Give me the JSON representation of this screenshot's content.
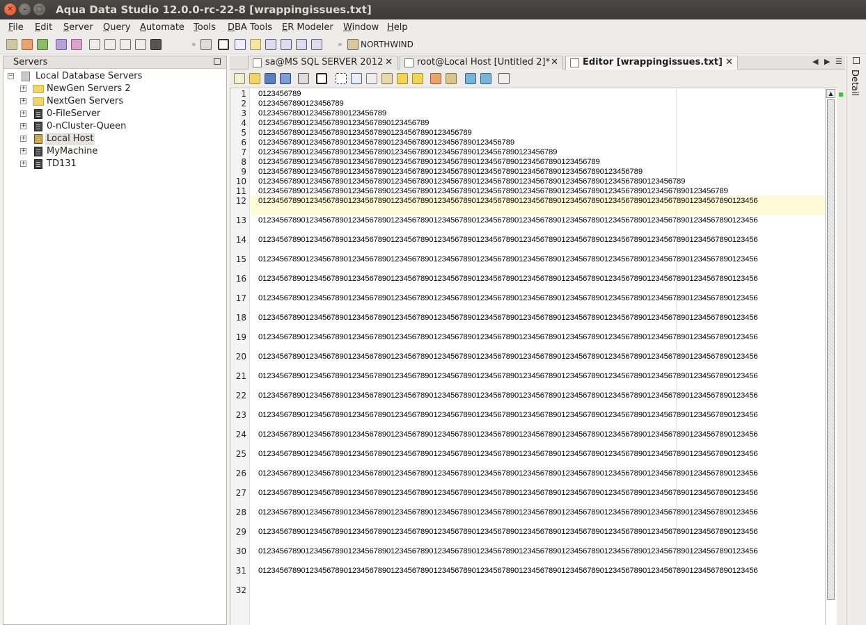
{
  "window": {
    "title": "Aqua Data Studio 12.0.0-rc-22-8 [wrappingissues.txt]"
  },
  "menu": [
    "File",
    "Edit",
    "Server",
    "Query",
    "Automate",
    "Tools",
    "DBA Tools",
    "ER Modeler",
    "Window",
    "Help"
  ],
  "toolbar": {
    "connection_label": "NORTHWIND"
  },
  "servers_panel": {
    "title": "Servers",
    "root": "Local Database Servers",
    "items": [
      {
        "label": "NewGen Servers 2",
        "icon": "folder-icon"
      },
      {
        "label": "NextGen Servers",
        "icon": "folder-icon"
      },
      {
        "label": "0-FileServer",
        "icon": "server-icon"
      },
      {
        "label": "0-nCluster-Queen",
        "icon": "server-icon"
      },
      {
        "label": "Local Host",
        "icon": "server-icon",
        "selected": true
      },
      {
        "label": "MyMachine",
        "icon": "server-icon"
      },
      {
        "label": "TD131",
        "icon": "server-icon"
      }
    ]
  },
  "tabs": [
    {
      "label": "sa@MS SQL SERVER 2012"
    },
    {
      "label": "root@Local Host [Untitled 2]*"
    },
    {
      "label": "Editor [wrappingissues.txt]",
      "active": true
    }
  ],
  "detail_panel": {
    "label": "Detail"
  },
  "editor": {
    "lines": [
      "0123456789",
      "01234567890123456789",
      "012345678901234567890123456789",
      "0123456789012345678901234567890123456789",
      "01234567890123456789012345678901234567890123456789",
      "012345678901234567890123456789012345678901234567890123456789",
      "0123456789012345678901234567890123456789012345678901234567890123456789",
      "01234567890123456789012345678901234567890123456789012345678901234567890123456789",
      "012345678901234567890123456789012345678901234567890123456789012345678901234567890123456789",
      "0123456789012345678901234567890123456789012345678901234567890123456789012345678901234567890123456789",
      "01234567890123456789012345678901234567890123456789012345678901234567890123456789012345678901234567890123456789",
      "012345678901234567890123456789012345678901234567890123456789012345678901234567890123456789012345678901234567890123456",
      "012345678901234567890123456789012345678901234567890123456789012345678901234567890123456789012345678901234567890123456",
      "012345678901234567890123456789012345678901234567890123456789012345678901234567890123456789012345678901234567890123456",
      "012345678901234567890123456789012345678901234567890123456789012345678901234567890123456789012345678901234567890123456",
      "012345678901234567890123456789012345678901234567890123456789012345678901234567890123456789012345678901234567890123456",
      "012345678901234567890123456789012345678901234567890123456789012345678901234567890123456789012345678901234567890123456",
      "012345678901234567890123456789012345678901234567890123456789012345678901234567890123456789012345678901234567890123456",
      "012345678901234567890123456789012345678901234567890123456789012345678901234567890123456789012345678901234567890123456",
      "012345678901234567890123456789012345678901234567890123456789012345678901234567890123456789012345678901234567890123456",
      "012345678901234567890123456789012345678901234567890123456789012345678901234567890123456789012345678901234567890123456",
      "012345678901234567890123456789012345678901234567890123456789012345678901234567890123456789012345678901234567890123456",
      "012345678901234567890123456789012345678901234567890123456789012345678901234567890123456789012345678901234567890123456",
      "012345678901234567890123456789012345678901234567890123456789012345678901234567890123456789012345678901234567890123456",
      "012345678901234567890123456789012345678901234567890123456789012345678901234567890123456789012345678901234567890123456",
      "012345678901234567890123456789012345678901234567890123456789012345678901234567890123456789012345678901234567890123456",
      "012345678901234567890123456789012345678901234567890123456789012345678901234567890123456789012345678901234567890123456",
      "012345678901234567890123456789012345678901234567890123456789012345678901234567890123456789012345678901234567890123456",
      "012345678901234567890123456789012345678901234567890123456789012345678901234567890123456789012345678901234567890123456",
      "012345678901234567890123456789012345678901234567890123456789012345678901234567890123456789012345678901234567890123456",
      "012345678901234567890123456789012345678901234567890123456789012345678901234567890123456789012345678901234567890123456",
      ""
    ]
  }
}
